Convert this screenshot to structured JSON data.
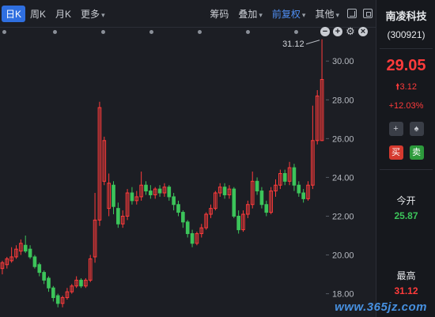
{
  "toolbar": {
    "periods": [
      "日K",
      "周K",
      "月K"
    ],
    "more_label": "更多",
    "chip_label": "筹码",
    "overlay_label": "叠加",
    "adjust_label": "前复权",
    "other_label": "其他"
  },
  "chart": {
    "peak_label": "31.12",
    "y_ticks": [
      "30.00",
      "28.00",
      "26.00",
      "24.00",
      "22.00",
      "20.00",
      "18.00"
    ],
    "up_color": "#ff3b3b",
    "down_color": "#3cc45a"
  },
  "chart_data": {
    "type": "candlestick",
    "ylim": [
      16.8,
      31.6
    ],
    "y_ticks": [
      30,
      28,
      26,
      24,
      22,
      20,
      18
    ],
    "peak_annotation": 31.12,
    "candles": [
      [
        19.3,
        19.6,
        19.0,
        19.7
      ],
      [
        19.5,
        19.8,
        19.3,
        19.9
      ],
      [
        19.7,
        19.9,
        19.6,
        20.4
      ],
      [
        19.9,
        20.3,
        19.8,
        20.5
      ],
      [
        20.2,
        20.6,
        20.0,
        20.8
      ],
      [
        20.5,
        20.2,
        20.1,
        21.0
      ],
      [
        20.3,
        19.9,
        19.8,
        20.5
      ],
      [
        19.9,
        19.4,
        19.3,
        20.0
      ],
      [
        19.5,
        19.1,
        18.9,
        19.6
      ],
      [
        19.1,
        18.7,
        18.5,
        19.2
      ],
      [
        18.8,
        18.3,
        18.1,
        18.9
      ],
      [
        18.3,
        17.8,
        17.6,
        18.4
      ],
      [
        17.9,
        17.5,
        17.3,
        18.0
      ],
      [
        17.5,
        17.8,
        17.3,
        17.9
      ],
      [
        17.8,
        18.1,
        17.7,
        18.3
      ],
      [
        18.1,
        18.4,
        18.0,
        18.5
      ],
      [
        18.4,
        18.7,
        18.3,
        18.9
      ],
      [
        18.7,
        18.4,
        18.3,
        18.8
      ],
      [
        18.4,
        18.7,
        18.3,
        18.8
      ],
      [
        18.7,
        19.8,
        18.6,
        20.0
      ],
      [
        19.9,
        21.8,
        19.6,
        23.2
      ],
      [
        21.8,
        27.6,
        21.5,
        27.9
      ],
      [
        23.8,
        25.9,
        23.6,
        26.1
      ],
      [
        22.4,
        23.7,
        22.0,
        24.2
      ],
      [
        23.6,
        22.5,
        22.1,
        23.8
      ],
      [
        22.4,
        21.6,
        21.4,
        22.7
      ],
      [
        21.6,
        22.0,
        21.4,
        22.3
      ],
      [
        22.0,
        23.2,
        21.8,
        23.4
      ],
      [
        23.2,
        22.8,
        22.6,
        23.5
      ],
      [
        22.8,
        23.0,
        22.6,
        23.3
      ],
      [
        23.0,
        23.6,
        22.8,
        24.3
      ],
      [
        23.6,
        23.3,
        23.1,
        23.8
      ],
      [
        23.3,
        23.1,
        22.9,
        23.6
      ],
      [
        23.1,
        23.4,
        22.9,
        23.5
      ],
      [
        23.4,
        23.2,
        23.0,
        23.6
      ],
      [
        23.2,
        23.5,
        23.0,
        23.7
      ],
      [
        23.5,
        23.0,
        22.8,
        23.6
      ],
      [
        23.0,
        22.6,
        22.3,
        23.2
      ],
      [
        22.6,
        22.2,
        22.0,
        22.8
      ],
      [
        22.2,
        21.7,
        21.4,
        22.3
      ],
      [
        21.7,
        21.1,
        20.9,
        21.8
      ],
      [
        21.1,
        20.6,
        20.4,
        21.3
      ],
      [
        20.6,
        21.1,
        20.5,
        21.2
      ],
      [
        21.1,
        21.4,
        20.9,
        21.6
      ],
      [
        21.4,
        22.1,
        21.3,
        22.2
      ],
      [
        22.1,
        22.4,
        21.9,
        22.6
      ],
      [
        22.4,
        23.2,
        22.3,
        23.3
      ],
      [
        23.2,
        23.5,
        23.0,
        23.7
      ],
      [
        23.5,
        23.1,
        22.9,
        23.7
      ],
      [
        23.1,
        23.4,
        22.9,
        23.6
      ],
      [
        23.4,
        22.0,
        21.9,
        23.5
      ],
      [
        22.0,
        21.3,
        21.1,
        22.3
      ],
      [
        21.3,
        22.1,
        21.2,
        22.3
      ],
      [
        22.1,
        22.6,
        21.9,
        22.8
      ],
      [
        22.6,
        23.8,
        22.4,
        24.3
      ],
      [
        23.8,
        23.3,
        23.1,
        24.0
      ],
      [
        23.3,
        22.6,
        22.4,
        23.5
      ],
      [
        22.6,
        22.2,
        22.0,
        22.8
      ],
      [
        22.2,
        23.3,
        22.1,
        23.5
      ],
      [
        23.3,
        23.6,
        23.0,
        23.9
      ],
      [
        23.6,
        24.2,
        23.4,
        24.4
      ],
      [
        24.2,
        23.8,
        23.6,
        24.4
      ],
      [
        23.8,
        24.5,
        23.6,
        24.8
      ],
      [
        24.5,
        23.6,
        23.3,
        24.7
      ],
      [
        23.6,
        23.2,
        23.0,
        23.8
      ],
      [
        23.2,
        22.9,
        22.7,
        23.4
      ],
      [
        22.9,
        23.6,
        22.8,
        23.8
      ],
      [
        23.6,
        25.9,
        23.4,
        27.7
      ],
      [
        25.9,
        28.2,
        25.7,
        28.5
      ],
      [
        25.9,
        29.05,
        25.87,
        31.12
      ]
    ]
  },
  "panel": {
    "stock_name": "南凌科技",
    "stock_code": "(300921)",
    "price": "29.05",
    "change": "3.12",
    "change_pct": "+12.03%",
    "buy_label": "买",
    "sell_label": "卖",
    "open_label": "今开",
    "open_value": "25.87",
    "high_label": "最高",
    "high_value": "31.12"
  },
  "watermark": "www.365jz.com"
}
